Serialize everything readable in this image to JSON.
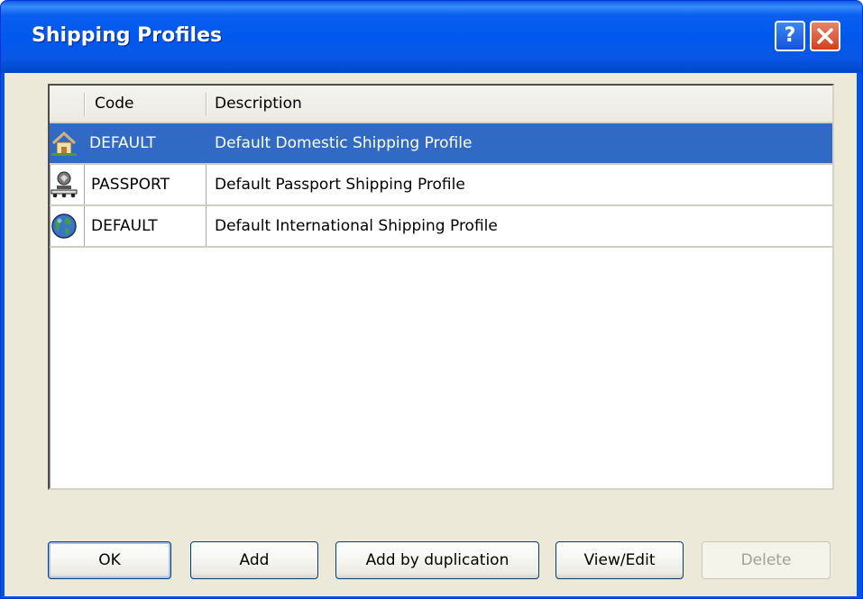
{
  "window": {
    "title": "Shipping Profiles",
    "help_label": "?",
    "colors": {
      "titlebar": "#0058ee",
      "selection": "#316ac5",
      "face": "#ece9d8"
    }
  },
  "list": {
    "columns": [
      {
        "label": "Code"
      },
      {
        "label": "Description"
      }
    ],
    "rows": [
      {
        "icon": "home-icon",
        "code": "DEFAULT",
        "description": "Default Domestic Shipping Profile",
        "selected": true
      },
      {
        "icon": "passport-icon",
        "code": "PASSPORT",
        "description": "Default Passport Shipping Profile",
        "selected": false
      },
      {
        "icon": "globe-icon",
        "code": "DEFAULT",
        "description": "Default International Shipping Profile",
        "selected": false
      }
    ]
  },
  "buttons": {
    "ok": "OK",
    "add": "Add",
    "add_dup": "Add by duplication",
    "view_edit": "View/Edit",
    "delete": "Delete"
  }
}
